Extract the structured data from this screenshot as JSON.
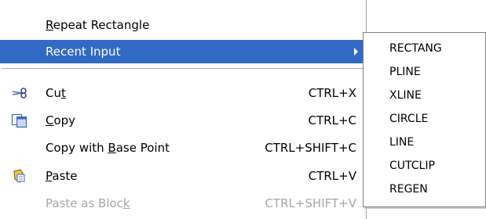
{
  "context_menu": {
    "items": [
      {
        "pre": "",
        "ul": "R",
        "post": "epeat Rectangle",
        "shortcut": ""
      },
      {
        "pre": "",
        "ul": "",
        "post": "Recent Input",
        "shortcut": ""
      },
      {
        "pre": "Cu",
        "ul": "t",
        "post": "",
        "shortcut": "CTRL+X"
      },
      {
        "pre": "",
        "ul": "C",
        "post": "opy",
        "shortcut": "CTRL+C"
      },
      {
        "pre": "Copy with ",
        "ul": "B",
        "post": "ase Point",
        "shortcut": "CTRL+SHIFT+C"
      },
      {
        "pre": "",
        "ul": "P",
        "post": "aste",
        "shortcut": "CTRL+V"
      },
      {
        "pre": "Paste as Bloc",
        "ul": "k",
        "post": "",
        "shortcut": "CTRL+SHIFT+V"
      }
    ],
    "icons": {
      "cut": "scissors-icon",
      "copy": "copy-icon",
      "paste": "paste-icon",
      "submenu": "submenu-arrow-icon"
    }
  },
  "recent_input_submenu": {
    "items": [
      "RECTANG",
      "PLINE",
      "XLINE",
      "CIRCLE",
      "LINE",
      "CUTCLIP",
      "REGEN"
    ]
  },
  "colors": {
    "highlight": "#316ac5",
    "highlight_text": "#ffffff",
    "disabled_text": "#a7a6aa",
    "border": "#a7a6aa"
  }
}
